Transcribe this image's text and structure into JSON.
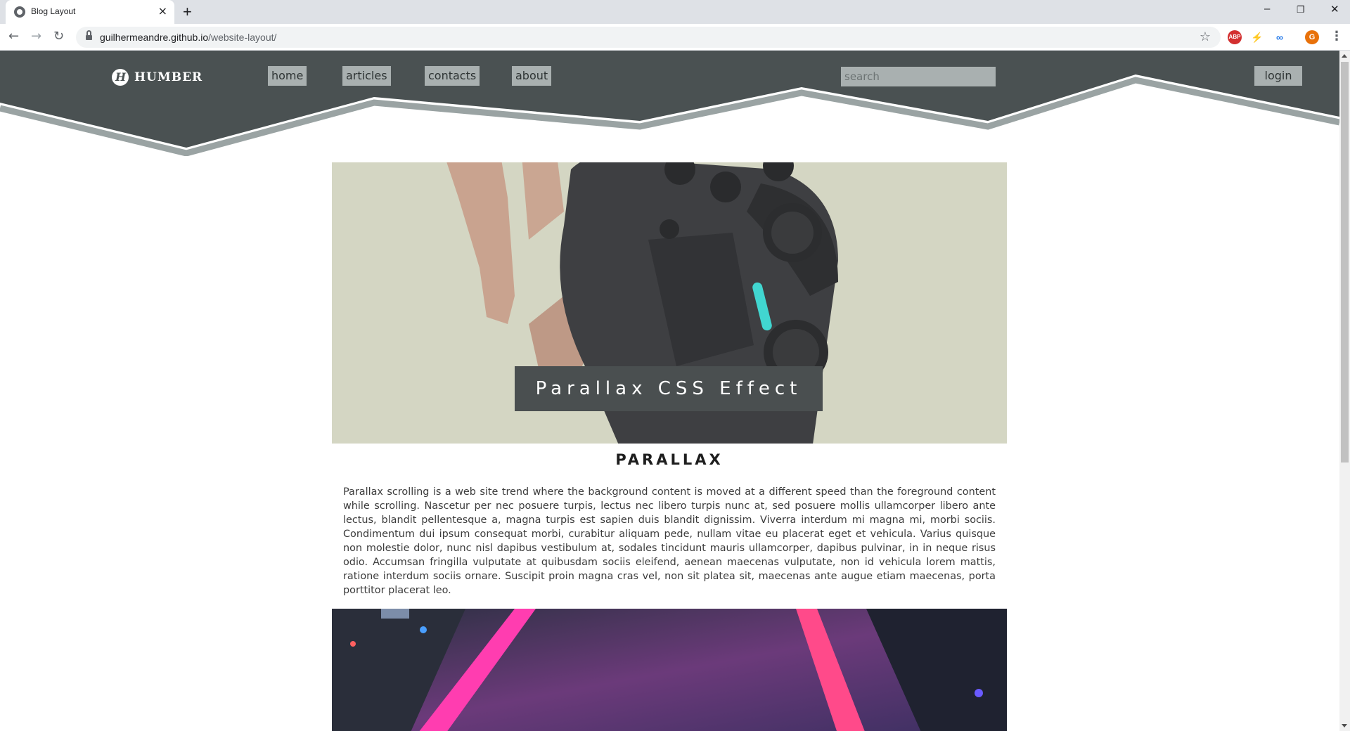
{
  "browser": {
    "tab_title": "Blog Layout",
    "tab_close": "×",
    "new_tab": "+",
    "url_host": "guilhermeandre.github.io",
    "url_path": "/website-layout/",
    "controls": {
      "minimize": "–",
      "restore": "❐",
      "close": "✕"
    },
    "extensions": [
      {
        "name": "adblock-icon",
        "label": "ABP",
        "color": "#d32f2f"
      },
      {
        "name": "profile-avatar",
        "label": "G",
        "color": "#e8710a"
      }
    ]
  },
  "header": {
    "logo_text": "HUMBER",
    "nav": [
      {
        "label": "home"
      },
      {
        "label": "articles"
      },
      {
        "label": "contacts"
      },
      {
        "label": "about"
      }
    ],
    "search_placeholder": "search",
    "login_label": "login"
  },
  "hero": {
    "caption": "Parallax CSS Effect"
  },
  "section": {
    "title": "PARALLAX",
    "body": "Parallax scrolling is a web site trend where the background content is moved at a different speed than the foreground content while scrolling. Nascetur per nec posuere turpis, lectus nec libero turpis nunc at, sed posuere mollis ullamcorper libero ante lectus, blandit pellentesque a, magna turpis est sapien duis blandit dignissim. Viverra interdum mi magna mi, morbi sociis. Condimentum dui ipsum consequat morbi, curabitur aliquam pede, nullam vitae eu placerat eget et vehicula. Varius quisque non molestie dolor, nunc nisl dapibus vestibulum at, sodales tincidunt mauris ullamcorper, dapibus pulvinar, in in neque risus odio. Accumsan fringilla vulputate at quibusdam sociis eleifend, aenean maecenas vulputate, non id vehicula lorem mattis, ratione interdum sociis ornare. Suscipit proin magna cras vel, non sit platea sit, maecenas ante augue etiam maecenas, porta porttitor placerat leo."
  },
  "colors": {
    "header_bg": "#4a5152",
    "header_stripe": "#9aa3a3",
    "nav_button_bg": "#a9b0b0",
    "caption_bg": "#4a4f50"
  }
}
